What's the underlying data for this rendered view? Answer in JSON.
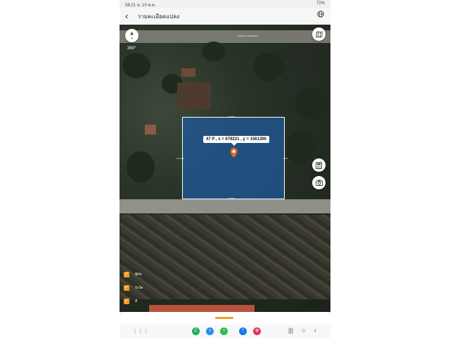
{
  "status_bar": {
    "time": "08:21",
    "date": "ห. 10 พ.ค.",
    "battery": "72%"
  },
  "app_bar": {
    "title": "รายละเอียดแปลง"
  },
  "map": {
    "view_mode_label": "360°",
    "road_label": "Waxoa uuqmaio",
    "parcel": {
      "marker_text": "47 P , x = 679221 , y = 1561390",
      "dim_top": "47.58 ม.",
      "dim_bottom": "47.58 ม.",
      "dim_left": "37.10 ม.",
      "dim_right": "38 ม.",
      "fill_color": "#1e5aa0",
      "border_color": "#ffffff"
    },
    "layers": [
      {
        "label": "พิกัด",
        "checked": true
      },
      {
        "label": "รังวัด",
        "checked": true
      },
      {
        "label": "สี",
        "checked": true
      }
    ],
    "accent_color": "#f39a1e"
  },
  "nav": {
    "apps": [
      "green-app",
      "chat-app",
      "message-app",
      "facebook-app",
      "flower-app"
    ]
  }
}
